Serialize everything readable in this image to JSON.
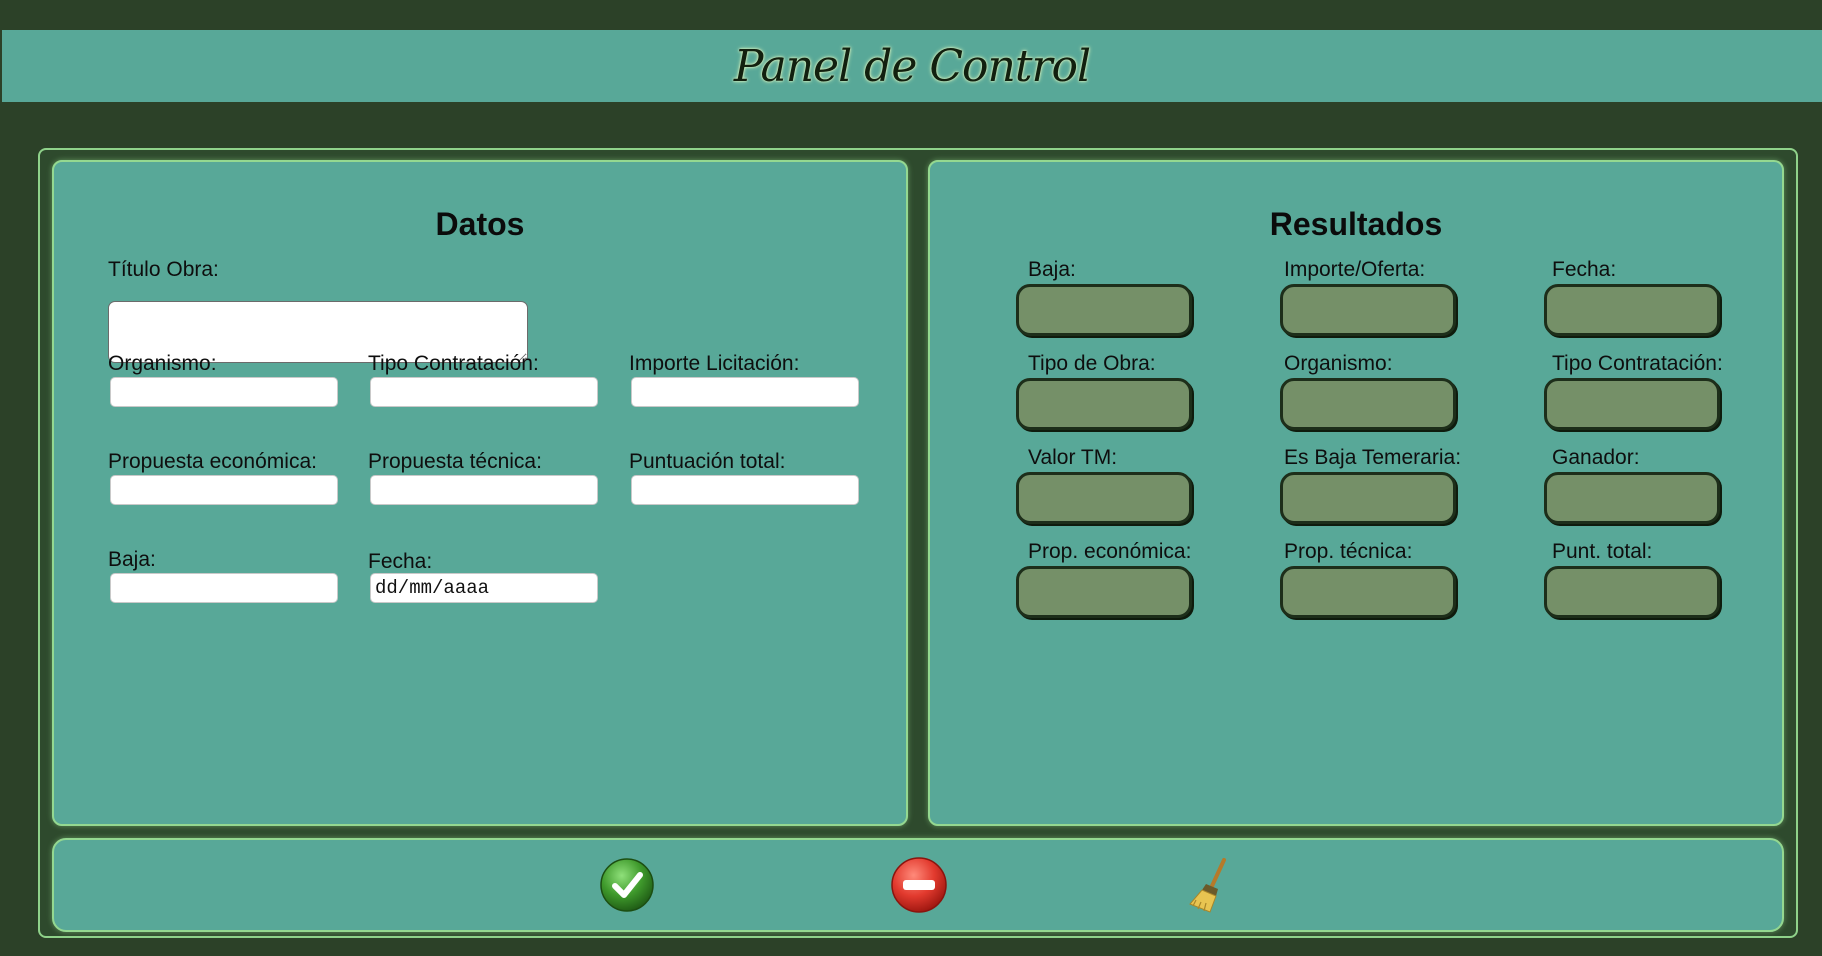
{
  "header": {
    "title": "Panel de Control"
  },
  "datos": {
    "title": "Datos",
    "titulo_obra_label": "Título Obra:",
    "organismo_label": "Organismo:",
    "tipo_contratacion_label": "Tipo Contratación:",
    "importe_licitacion_label": "Importe Licitación:",
    "propuesta_economica_label": "Propuesta económica:",
    "propuesta_tecnica_label": "Propuesta técnica:",
    "puntuacion_total_label": "Puntuación total:",
    "baja_label": "Baja:",
    "fecha_label": "Fecha:",
    "fecha_placeholder": "dd/mm/aaaa"
  },
  "resultados": {
    "title": "Resultados",
    "labels": [
      "Baja:",
      "Importe/Oferta:",
      "Fecha:",
      "Tipo de Obra:",
      "Organismo:",
      "Tipo Contratación:",
      "Valor TM:",
      "Es Baja Temeraria:",
      "Ganador:",
      "Prop. económica:",
      "Prop. técnica:",
      "Punt. total:"
    ]
  },
  "actions": {
    "accept_icon": "check-icon",
    "cancel_icon": "no-entry-icon",
    "clear_icon": "broom-icon"
  },
  "colors": {
    "background": "#2c4128",
    "panel": "#58a898",
    "panel_border": "#94d890",
    "output_field": "#759068",
    "accept_green": "#3f9a2c",
    "cancel_red": "#e23a2e"
  }
}
